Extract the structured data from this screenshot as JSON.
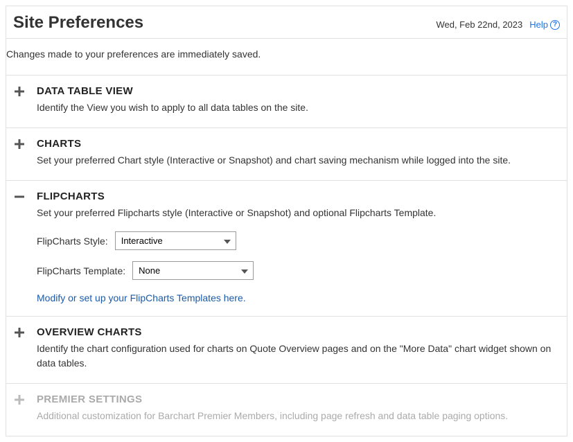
{
  "header": {
    "title": "Site Preferences",
    "date": "Wed, Feb 22nd, 2023",
    "help_label": "Help"
  },
  "intro": "Changes made to your preferences are immediately saved.",
  "sections": {
    "data_table": {
      "title": "DATA TABLE VIEW",
      "desc": "Identify the View you wish to apply to all data tables on the site."
    },
    "charts": {
      "title": "CHARTS",
      "desc": "Set your preferred Chart style (Interactive or Snapshot) and chart saving mechanism while logged into the site."
    },
    "flipcharts": {
      "title": "FLIPCHARTS",
      "desc": "Set your preferred Flipcharts style (Interactive or Snapshot) and optional Flipcharts Template.",
      "style_label": "FlipCharts Style:",
      "style_value": "Interactive",
      "template_label": "FlipCharts Template:",
      "template_value": "None",
      "link_text": "Modify or set up your FlipCharts Templates here."
    },
    "overview": {
      "title": "OVERVIEW CHARTS",
      "desc": "Identify the chart configuration used for charts on Quote Overview pages and on the \"More Data\" chart widget shown on data tables."
    },
    "premier": {
      "title": "PREMIER SETTINGS",
      "desc": "Additional customization for Barchart Premier Members, including page refresh and data table paging options."
    }
  }
}
